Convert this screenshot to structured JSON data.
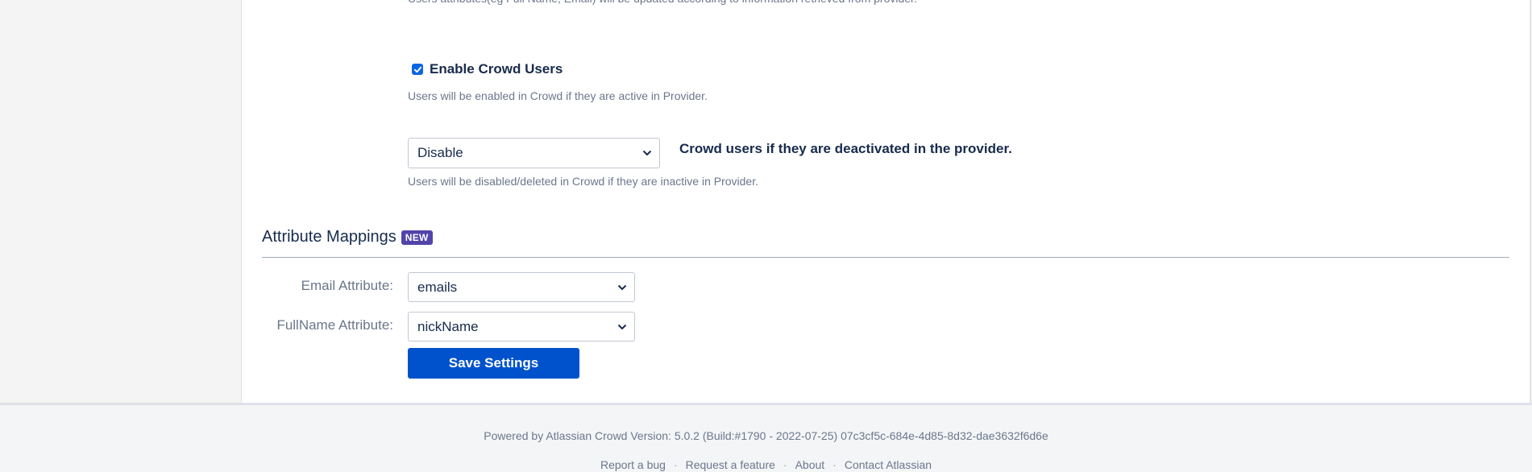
{
  "truncated_text": "Users attributes(eg Full Name, Email) will be updated according to information retrieved from provider.",
  "enable_users": {
    "checked": true,
    "label": "Enable Crowd Users",
    "description": "Users will be enabled in Crowd if they are active in Provider."
  },
  "deactivation": {
    "selected": "Disable",
    "label": "Crowd users if they are deactivated in the provider.",
    "description": "Users will be disabled/deleted in Crowd if they are inactive in Provider."
  },
  "attribute_mappings": {
    "title": "Attribute Mappings",
    "badge": "NEW",
    "email_label": "Email Attribute:",
    "email_value": "emails",
    "fullname_label": "FullName Attribute:",
    "fullname_value": "nickName",
    "save_label": "Save Settings"
  },
  "footer": {
    "powered_by": "Powered by Atlassian Crowd Version: 5.0.2 (Build:#1790 - 2022-07-25) 07c3cf5c-684e-4d85-8d32-dae3632f6d6e",
    "links": [
      "Report a bug",
      "Request a feature",
      "About",
      "Contact Atlassian"
    ],
    "separator": "·"
  },
  "colors": {
    "primary": "#0052cc",
    "badge": "#5243aa",
    "checkbox": "#0c66e4"
  }
}
